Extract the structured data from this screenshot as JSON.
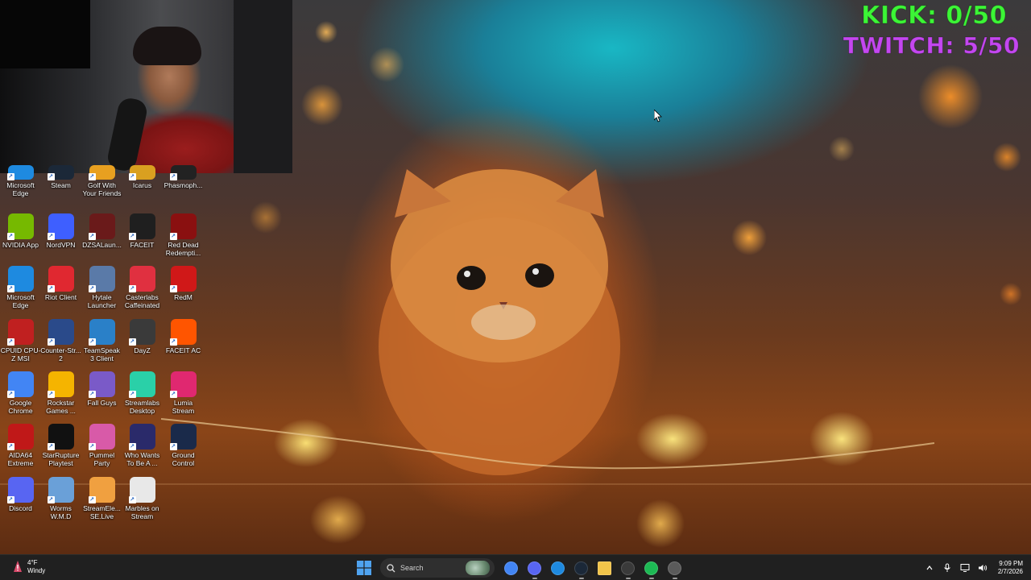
{
  "overlay": {
    "kick": "KICK: 0/50",
    "twitch": "TWITCH: 5/50"
  },
  "desktop_icons": [
    {
      "label": "Microsoft Edge",
      "icon": "edge-icon",
      "color": "#1e8ae0"
    },
    {
      "label": "Steam",
      "icon": "steam-icon",
      "color": "#1b2838"
    },
    {
      "label": "Golf With Your Friends",
      "icon": "golf-icon",
      "color": "#e8a020"
    },
    {
      "label": "Icarus",
      "icon": "icarus-icon",
      "color": "#d9a020"
    },
    {
      "label": "Phasmoph...",
      "icon": "phasmophobia-icon",
      "color": "#222222"
    },
    {
      "label": "NVIDIA App",
      "icon": "nvidia-icon",
      "color": "#76b900"
    },
    {
      "label": "NordVPN",
      "icon": "nordvpn-icon",
      "color": "#3e5fff"
    },
    {
      "label": "DZSALaun...",
      "icon": "dzsa-icon",
      "color": "#6a1a1a"
    },
    {
      "label": "FACEIT",
      "icon": "faceit-icon",
      "color": "#1f1f1f"
    },
    {
      "label": "Red Dead Redempti...",
      "icon": "red-dead-icon",
      "color": "#8a1010"
    },
    {
      "label": "Microsoft Edge",
      "icon": "edge-icon",
      "color": "#1e8ae0"
    },
    {
      "label": "Riot Client",
      "icon": "riot-icon",
      "color": "#e02830"
    },
    {
      "label": "Hytale Launcher",
      "icon": "hytale-icon",
      "color": "#5a7aa8"
    },
    {
      "label": "Casterlabs Caffeinated",
      "icon": "casterlabs-icon",
      "color": "#e03040"
    },
    {
      "label": "RedM",
      "icon": "redm-icon",
      "color": "#d01818"
    },
    {
      "label": "CPUID CPU-Z MSI",
      "icon": "cpuz-icon",
      "color": "#c02020"
    },
    {
      "label": "Counter-Str... 2",
      "icon": "cs2-icon",
      "color": "#2a4a8a"
    },
    {
      "label": "TeamSpeak 3 Client",
      "icon": "teamspeak-icon",
      "color": "#2a80c8"
    },
    {
      "label": "DayZ",
      "icon": "dayz-icon",
      "color": "#3a3a3a"
    },
    {
      "label": "FACEIT AC",
      "icon": "faceit-ac-icon",
      "color": "#ff5500"
    },
    {
      "label": "Google Chrome",
      "icon": "chrome-icon",
      "color": "#4285f4"
    },
    {
      "label": "Rockstar Games ...",
      "icon": "rockstar-icon",
      "color": "#f5b400"
    },
    {
      "label": "Fall Guys",
      "icon": "fall-guys-icon",
      "color": "#7a5ac8"
    },
    {
      "label": "Streamlabs Desktop",
      "icon": "streamlabs-icon",
      "color": "#2ad0a8"
    },
    {
      "label": "Lumia Stream",
      "icon": "lumia-icon",
      "color": "#e02870"
    },
    {
      "label": "AIDA64 Extreme",
      "icon": "aida64-icon",
      "color": "#c01818"
    },
    {
      "label": "StarRupture Playtest",
      "icon": "starrupture-icon",
      "color": "#111111"
    },
    {
      "label": "Pummel Party",
      "icon": "pummel-party-icon",
      "color": "#d85aa8"
    },
    {
      "label": "Who Wants To Be A ...",
      "icon": "millionaire-icon",
      "color": "#2a2a6a"
    },
    {
      "label": "Ground Control",
      "icon": "ground-control-icon",
      "color": "#1a2a4a"
    },
    {
      "label": "Discord",
      "icon": "discord-icon",
      "color": "#5865f2"
    },
    {
      "label": "Worms W.M.D",
      "icon": "worms-icon",
      "color": "#6aa0d8"
    },
    {
      "label": "StreamEle... SE.Live",
      "icon": "streamelements-icon",
      "color": "#f0a040"
    },
    {
      "label": "Marbles on Stream",
      "icon": "marbles-icon",
      "color": "#e8e8e8"
    }
  ],
  "taskbar": {
    "weather_temp": "4°F",
    "weather_desc": "Windy",
    "search_placeholder": "Search",
    "pinned": [
      {
        "name": "start-button",
        "icon": "windows-icon",
        "color": "#4fa3f0"
      },
      {
        "name": "chrome",
        "icon": "chrome-icon",
        "color": "#4285f4"
      },
      {
        "name": "discord",
        "icon": "discord-icon",
        "color": "#5865f2"
      },
      {
        "name": "edge",
        "icon": "edge-icon",
        "color": "#1e8ae0"
      },
      {
        "name": "steam",
        "icon": "steam-icon",
        "color": "#1b2838"
      },
      {
        "name": "file-explorer",
        "icon": "folder-icon",
        "color": "#f2c44a"
      },
      {
        "name": "obs",
        "icon": "obs-icon",
        "color": "#3a3a3a"
      },
      {
        "name": "spotify",
        "icon": "spotify-icon",
        "color": "#1db954"
      },
      {
        "name": "extra-app",
        "icon": "app-icon",
        "color": "#5a5a5a"
      }
    ],
    "time": "9:09 PM",
    "date": "2/7/2026"
  }
}
